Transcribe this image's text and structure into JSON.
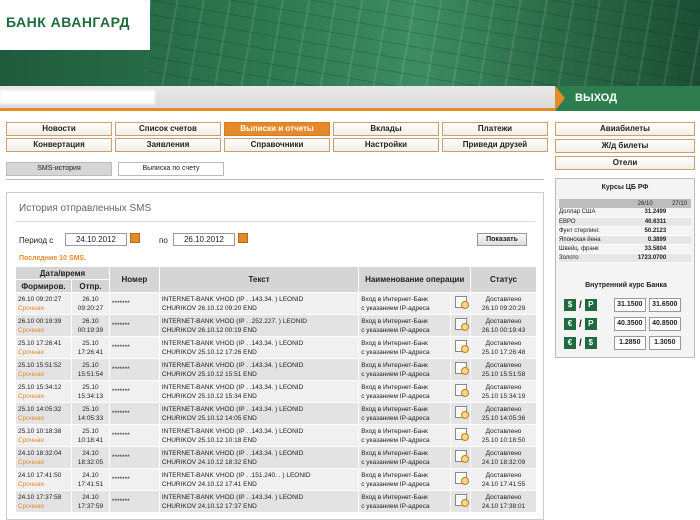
{
  "header": {
    "logo": "БАНК АВАНГАРД",
    "exit": "ВЫХОД"
  },
  "nav": [
    "Новости",
    "Список счетов",
    "Выписки и отчеты",
    "Вклады",
    "Платежи",
    "Конвертация",
    "Заявления",
    "Справочники",
    "Настройки",
    "Приведи друзей"
  ],
  "active_nav": "Выписки и отчеты",
  "sub_tabs": [
    "SMS-история",
    "Выписка по счету"
  ],
  "right_links": [
    "Авиабилеты",
    "Ж/д билеты",
    "Отели"
  ],
  "rates": {
    "title": "Курсы ЦБ РФ",
    "cols": [
      "26/10",
      "27/10"
    ],
    "rows": [
      [
        "Доллар США",
        "31.2499",
        ""
      ],
      [
        "ЕВРО",
        "40.6311",
        ""
      ],
      [
        "Фунт стерлинг.",
        "50.2123",
        ""
      ],
      [
        "Японская йена",
        "0.3899",
        ""
      ],
      [
        "Швейц. франк",
        "33.5804",
        ""
      ],
      [
        "Золото",
        "1723.0700",
        ""
      ]
    ],
    "internal_title": "Внутренний курс Банка",
    "internal": [
      {
        "from": "$",
        "to": "Р",
        "buy": "31.1500",
        "sell": "31.6500"
      },
      {
        "from": "€",
        "to": "Р",
        "buy": "40.3500",
        "sell": "40.8500"
      },
      {
        "from": "€",
        "to": "$",
        "buy": "1.2850",
        "sell": "1.3050"
      }
    ]
  },
  "main": {
    "title": "История отправленных SMS",
    "period_label": "Период с",
    "date_from": "24.10.2012",
    "to_label": "по",
    "date_to": "26.10.2012",
    "show_button": "Показать",
    "last_label": "Последние 10 SMS."
  },
  "table": {
    "h_datetime": "Дата/время",
    "h_formed": "Формиров.",
    "h_sent": "Отпр.",
    "h_number": "Номер",
    "h_text": "Текст",
    "h_op": "Наименование операции",
    "h_status": "Статус",
    "rows": [
      {
        "f_dt": "26.10 09:20:27",
        "f_tag": "Срочная",
        "s_d": "26.10",
        "s_t": "09:20:27",
        "num": "*******",
        "t1": "INTERNET-BANK VHOD (IP . .143.34. ) LEONID",
        "t2": "CHURIKOV 26.10.12 09:20 END",
        "o1": "Вход в Интернет-Банк",
        "o2": "с указанием IP-адреса",
        "st": "Доставлено",
        "st_dt": "26.10 09:20:29"
      },
      {
        "f_dt": "26.10 00:19:39",
        "f_tag": "Срочная",
        "s_d": "26.10",
        "s_t": "00:19:39",
        "num": "*******",
        "t1": "INTERNET-BANK VHOD (IP . .252.227. ) LEONID",
        "t2": "CHURIKOV 26.10.12 00:19 END",
        "o1": "Вход в Интернет-Банк",
        "o2": "с указанием IP-адреса",
        "st": "Доставлено",
        "st_dt": "26.10 00:19:43"
      },
      {
        "f_dt": "25.10 17:26:41",
        "f_tag": "Срочная",
        "s_d": "25.10",
        "s_t": "17:26:41",
        "num": "*******",
        "t1": "INTERNET-BANK VHOD (IP . .143.34. ) LEONID",
        "t2": "CHURIKOV 25.10.12 17:26 END",
        "o1": "Вход в Интернет-Банк",
        "o2": "с указанием IP-адреса",
        "st": "Доставлено",
        "st_dt": "25.10 17:26:48"
      },
      {
        "f_dt": "25.10 15:51:52",
        "f_tag": "Срочная",
        "s_d": "25.10",
        "s_t": "15:51:54",
        "num": "*******",
        "t1": "INTERNET-BANK VHOD (IP . .143.34. ) LEONID",
        "t2": "CHURIKOV 25.10.12 15:51 END",
        "o1": "Вход в Интернет-Банк",
        "o2": "с указанием IP-адреса",
        "st": "Доставлено",
        "st_dt": "25.10 15:51:58"
      },
      {
        "f_dt": "25.10 15:34:12",
        "f_tag": "Срочная",
        "s_d": "25.10",
        "s_t": "15:34:13",
        "num": "*******",
        "t1": "INTERNET-BANK VHOD (IP . .143.34. ) LEONID",
        "t2": "CHURIKOV 25.10.12 15:34 END",
        "o1": "Вход в Интернет-Банк",
        "o2": "с указанием IP-адреса",
        "st": "Доставлено",
        "st_dt": "25.10 15:34:19"
      },
      {
        "f_dt": "25.10 14:05:32",
        "f_tag": "Срочная",
        "s_d": "25.10",
        "s_t": "14:05:33",
        "num": "*******",
        "t1": "INTERNET-BANK VHOD (IP . .143.34. ) LEONID",
        "t2": "CHURIKOV 25.10.12 14:05 END",
        "o1": "Вход в Интернет-Банк",
        "o2": "с указанием IP-адреса",
        "st": "Доставлено",
        "st_dt": "25.10 14:05:36"
      },
      {
        "f_dt": "25.10 10:18:38",
        "f_tag": "Срочная",
        "s_d": "25.10",
        "s_t": "10:18:41",
        "num": "*******",
        "t1": "INTERNET-BANK VHOD (IP . .143.34. ) LEONID",
        "t2": "CHURIKOV 25.10.12 10:18 END",
        "o1": "Вход в Интернет-Банк",
        "o2": "с указанием IP-адреса",
        "st": "Доставлено",
        "st_dt": "25.10 10:18:50"
      },
      {
        "f_dt": "24.10 18:32:04",
        "f_tag": "Срочная",
        "s_d": "24.10",
        "s_t": "18:32:05",
        "num": "*******",
        "t1": "INTERNET-BANK VHOD (IP . .143.34. ) LEONID",
        "t2": "CHURIKOV 24.10.12 18:32 END",
        "o1": "Вход в Интернет-Банк",
        "o2": "с указанием IP-адреса",
        "st": "Доставлено",
        "st_dt": "24.10 18:32:09"
      },
      {
        "f_dt": "24.10 17:41:50",
        "f_tag": "Срочная",
        "s_d": "24.10",
        "s_t": "17:41:51",
        "num": "*******",
        "t1": "INTERNET-BANK VHOD (IP . .151.240. . ) LEONID",
        "t2": "CHURIKOV 24.10.12 17:41 END",
        "o1": "Вход в Интернет-Банк",
        "o2": "с указанием IP-адреса",
        "st": "Доставлено",
        "st_dt": "24.10 17:41:55"
      },
      {
        "f_dt": "24.10 17:37:58",
        "f_tag": "Срочная",
        "s_d": "24.10",
        "s_t": "17:37:59",
        "num": "*******",
        "t1": "INTERNET-BANK VHOD (IP . .143.34. ) LEONID",
        "t2": "CHURIKOV 24.10.12 17:37 END",
        "o1": "Вход в Интернет-Банк",
        "o2": "с указанием IP-адреса",
        "st": "Доставлено",
        "st_dt": "24.10 17:38:01"
      }
    ]
  }
}
